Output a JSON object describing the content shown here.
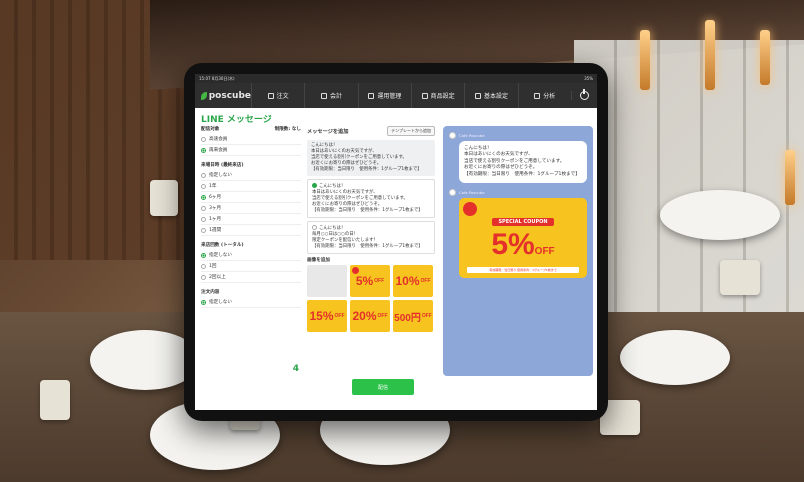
{
  "status_bar": {
    "time": "15:07",
    "date": "8月30日(木)",
    "battery": "35%"
  },
  "app": {
    "logo_text": "poscube"
  },
  "nav": [
    {
      "label": "注文",
      "icon": "edit-icon"
    },
    {
      "label": "会計",
      "icon": "register-icon"
    },
    {
      "label": "運用管理",
      "icon": "tag-icon"
    },
    {
      "label": "商品設定",
      "icon": "box-icon"
    },
    {
      "label": "基本設定",
      "icon": "gear-icon"
    },
    {
      "label": "分析",
      "icon": "chart-icon"
    }
  ],
  "page_title": "LINE メッセージ",
  "settings": {
    "target": {
      "heading": "配信対象",
      "limit_label": "制限数:",
      "limit_value": "なし",
      "options": [
        "高速会員",
        "再来会員"
      ],
      "selected": 1
    },
    "visit": {
      "heading": "来場日時 (最終来店)",
      "options": [
        "指定しない",
        "1年",
        "6ヶ月",
        "3ヶ月",
        "1ヶ月",
        "1週間"
      ],
      "selected": 2
    },
    "count": {
      "heading": "来店回数 (トータル)",
      "options": [
        "指定しない",
        "1回",
        "2回以上"
      ],
      "selected": 0
    },
    "order": {
      "heading": "注文内容",
      "options": [
        "指定しない"
      ],
      "selected": 0
    },
    "recipient_count": "4"
  },
  "compose": {
    "heading": "メッセージを追加",
    "template_button": "テンプレートから追加",
    "messages": [
      "こんにちは！\n本日はあいにくのお天気ですが、\n当店で使える割引クーポンをご用意しています。\nお近くにお寄りの際はぜひどうぞ。\n【有効期限：当日限り　使用条件：1グループ1枚まで】",
      "こんにちは！\n本日はあいにくのお天気ですが、\n当店で使える割引クーポンをご用意しています。\nお近くにお寄りの際はぜひどうぞ。\n【有効期限：当日限り　使用条件：1グループ1枚まで】",
      "こんにちは！\n毎月○○日は○○の日！\n限定クーポンを配信いたします！\n【有効期限：当日限り　使用条件：1グループ1枚まで】"
    ],
    "image_label": "画像を追加",
    "coupons": [
      {
        "value": "",
        "unit": ""
      },
      {
        "value": "5%",
        "unit": "OFF"
      },
      {
        "value": "10%",
        "unit": "OFF"
      },
      {
        "value": "15%",
        "unit": "OFF"
      },
      {
        "value": "20%",
        "unit": "OFF"
      },
      {
        "value": "500円",
        "unit": "OFF"
      }
    ]
  },
  "preview": {
    "sender": "Cafe Poscube",
    "text": "こんにちは！\n本日はあいにくのお天気ですが、\n当店で使える割引クーポンをご用意しています。\nお近くにお寄りの際はぜひどうぞ。\n【有効期限：当日限り　使用条件：1グループ1枚まで】",
    "coupon_banner": "SPECIAL COUPON",
    "coupon_value": "5%",
    "coupon_unit": "OFF",
    "coupon_footer": "有効期限：当日限り 使用条件：1グループ1枚まで"
  },
  "send_button": "配信"
}
